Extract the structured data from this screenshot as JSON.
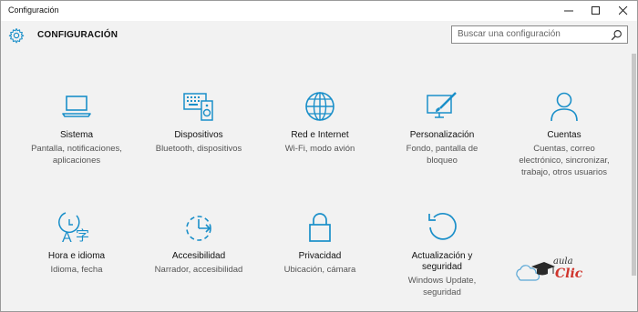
{
  "window": {
    "title": "Configuración"
  },
  "header": {
    "title": "CONFIGURACIÓN"
  },
  "search": {
    "placeholder": "Buscar una configuración"
  },
  "tiles": [
    {
      "label": "Sistema",
      "desc1": "Pantalla, notificaciones,",
      "desc2": "aplicaciones",
      "desc3": ""
    },
    {
      "label": "Dispositivos",
      "desc1": "Bluetooth, dispositivos",
      "desc2": "",
      "desc3": ""
    },
    {
      "label": "Red e Internet",
      "desc1": "Wi-Fi, modo avión",
      "desc2": "",
      "desc3": ""
    },
    {
      "label": "Personalización",
      "desc1": "Fondo, pantalla de",
      "desc2": "bloqueo",
      "desc3": ""
    },
    {
      "label": "Cuentas",
      "desc1": "Cuentas, correo",
      "desc2": "electrónico, sincronizar,",
      "desc3": "trabajo, otros usuarios"
    },
    {
      "label": "Hora e idioma",
      "desc1": "Idioma, fecha",
      "desc2": "",
      "desc3": ""
    },
    {
      "label": "Accesibilidad",
      "desc1": "Narrador, accesibilidad",
      "desc2": "",
      "desc3": ""
    },
    {
      "label": "Privacidad",
      "desc1": "Ubicación, cámara",
      "desc2": "",
      "desc3": ""
    },
    {
      "label1": "Actualización y",
      "label2": "seguridad",
      "desc1": "Windows Update,",
      "desc2": "seguridad",
      "desc3": ""
    }
  ],
  "logo": {
    "text1": "aula",
    "text2": "Clic"
  },
  "colors": {
    "accent": "#1a8fc9",
    "background": "#f2f2f2"
  }
}
